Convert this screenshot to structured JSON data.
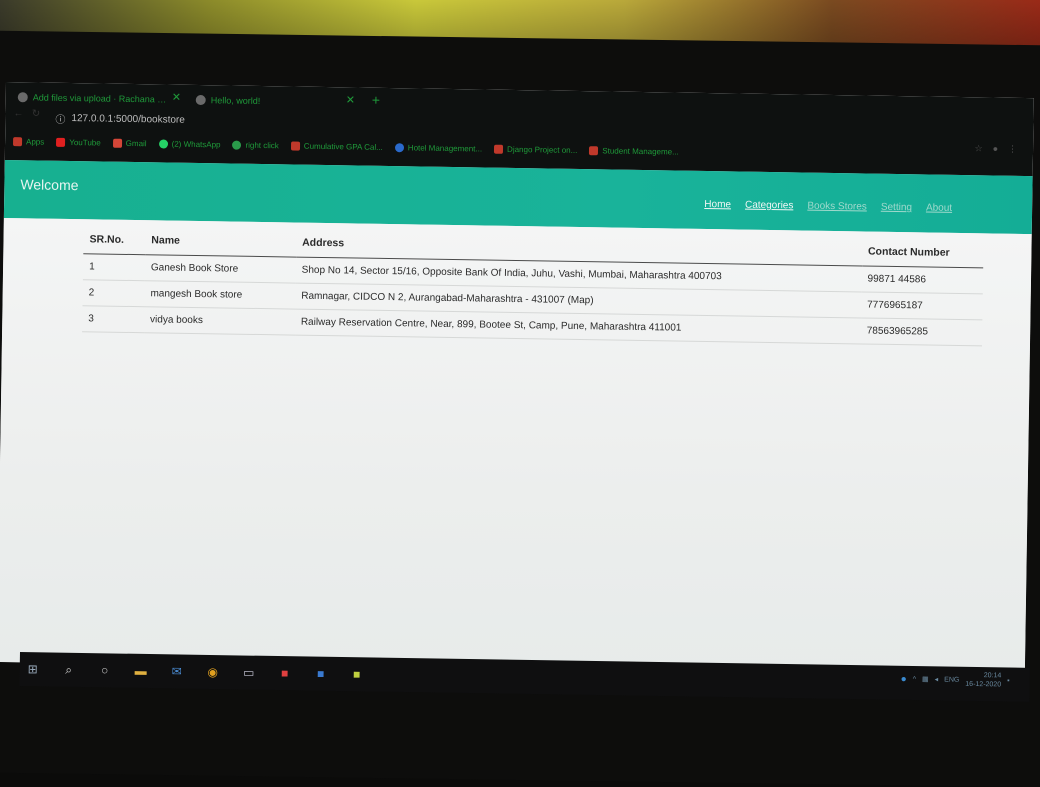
{
  "browser": {
    "tabs": [
      {
        "label": "Add files via upload · Rachana …"
      },
      {
        "label": "Hello, world!"
      }
    ],
    "url": "127.0.0.1:5000/bookstore",
    "bookmarks": [
      {
        "label": "Apps",
        "color": "#c0392b"
      },
      {
        "label": "YouTube",
        "color": "#e02020"
      },
      {
        "label": "Gmail",
        "color": "#d44638"
      },
      {
        "label": "(2) WhatsApp",
        "color": "#25d366"
      },
      {
        "label": "right click",
        "color": "#2a9a4a"
      },
      {
        "label": "Cumulative GPA Cal...",
        "color": "#c0392b"
      },
      {
        "label": "Hotel Management...",
        "color": "#2a6acb"
      },
      {
        "label": "Django Project on...",
        "color": "#c0392b"
      },
      {
        "label": "Student Manageme...",
        "color": "#c0392b"
      }
    ]
  },
  "app": {
    "brand": "Welcome",
    "nav": [
      {
        "label": "Home"
      },
      {
        "label": "Categories"
      },
      {
        "label": "Books Stores"
      },
      {
        "label": "Setting"
      },
      {
        "label": "About"
      }
    ]
  },
  "table": {
    "headers": [
      "SR.No.",
      "Name",
      "Address",
      "Contact Number"
    ],
    "rows": [
      [
        "1",
        "Ganesh Book Store",
        "Shop No 14, Sector 15/16, Opposite Bank Of India, Juhu, Vashi, Mumbai, Maharashtra 400703",
        "99871 44586"
      ],
      [
        "2",
        "mangesh Book store",
        "Ramnagar, CIDCO N 2, Aurangabad-Maharashtra - 431007 (Map)",
        "7776965187"
      ],
      [
        "3",
        "vidya books",
        "Railway Reservation Centre, Near, 899, Bootee St, Camp, Pune, Maharashtra 411001",
        "78563965285"
      ]
    ]
  },
  "taskbar": {
    "tray_lang": "ENG",
    "clock_time": "20:14",
    "clock_date": "16-12-2020"
  }
}
